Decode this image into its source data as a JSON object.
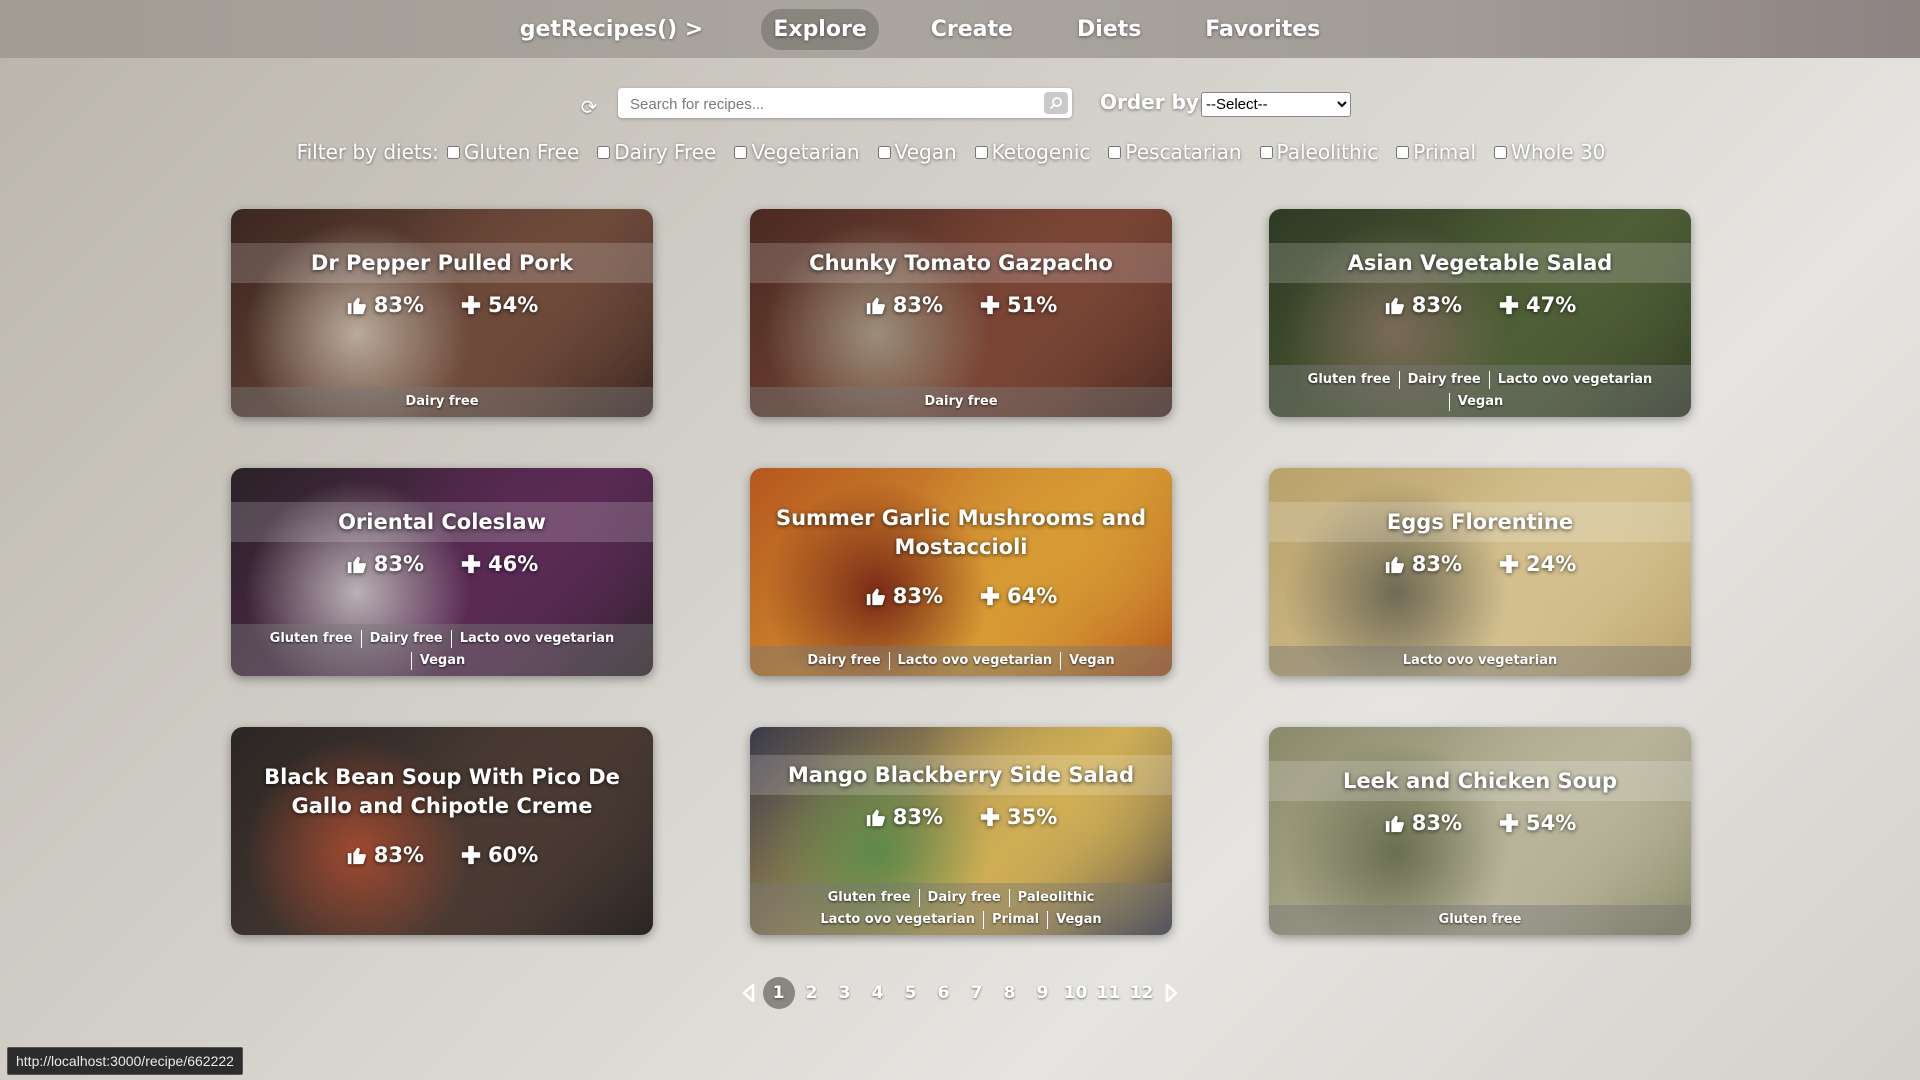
{
  "nav": {
    "brand": "getRecipes() >",
    "items": [
      "Explore",
      "Create",
      "Diets",
      "Favorites"
    ],
    "active": "Explore"
  },
  "search": {
    "placeholder": "Search for recipes...",
    "value": ""
  },
  "order": {
    "label": "Order by:",
    "selected": "--Select--"
  },
  "filters": {
    "label": "Filter by diets:",
    "options": [
      "Gluten Free",
      "Dairy Free",
      "Vegetarian",
      "Vegan",
      "Ketogenic",
      "Pescatarian",
      "Paleolithic",
      "Primal",
      "Whole 30"
    ]
  },
  "recipes": [
    {
      "title": "Dr Pepper Pulled Pork",
      "likes": "83%",
      "health": "54%",
      "diets": [
        "Dairy free"
      ],
      "colors": [
        "#3b2620",
        "#6e4a3a",
        "#b9aa9a"
      ]
    },
    {
      "title": "Chunky Tomato Gazpacho",
      "likes": "83%",
      "health": "51%",
      "diets": [
        "Dairy free"
      ],
      "colors": [
        "#4a2a22",
        "#7a4535",
        "#9b8e7a"
      ]
    },
    {
      "title": "Asian Vegetable Salad",
      "likes": "83%",
      "health": "47%",
      "diets": [
        "Gluten free",
        "Dairy free",
        "Lacto ovo vegetarian",
        "Vegan"
      ],
      "colors": [
        "#2e3a24",
        "#4e5e36",
        "#7a6a58"
      ]
    },
    {
      "title": "Oriental Coleslaw",
      "likes": "83%",
      "health": "46%",
      "diets": [
        "Gluten free",
        "Dairy free",
        "Lacto ovo vegetarian",
        "Vegan"
      ],
      "colors": [
        "#2a2226",
        "#5a2a55",
        "#b9b0b4"
      ]
    },
    {
      "title": "Summer Garlic Mushrooms and Mostaccioli",
      "likes": "83%",
      "health": "64%",
      "diets": [
        "Dairy free",
        "Lacto ovo vegetarian",
        "Vegan"
      ],
      "colors": [
        "#b5571e",
        "#d79a34",
        "#7a2a16"
      ]
    },
    {
      "title": "Eggs Florentine",
      "likes": "83%",
      "health": "24%",
      "diets": [
        "Lacto ovo vegetarian"
      ],
      "colors": [
        "#b9a16a",
        "#d3c08e",
        "#6f6a55"
      ]
    },
    {
      "title": "Black Bean Soup With Pico De Gallo and Chipotle Creme",
      "likes": "83%",
      "health": "60%",
      "diets": [],
      "colors": [
        "#2b2624",
        "#4a3a33",
        "#a04a30"
      ]
    },
    {
      "title": "Mango Blackberry Side Salad",
      "likes": "83%",
      "health": "35%",
      "diets": [
        "Gluten free",
        "Dairy free",
        "Paleolithic",
        "Lacto ovo vegetarian",
        "Primal",
        "Vegan"
      ],
      "colors": [
        "#3a3a4a",
        "#cfae55",
        "#5e8a4a"
      ]
    },
    {
      "title": "Leek and Chicken Soup",
      "likes": "83%",
      "health": "54%",
      "diets": [
        "Gluten free"
      ],
      "colors": [
        "#8a8a6a",
        "#b8b49a",
        "#6a6e50"
      ]
    }
  ],
  "pagination": {
    "pages": [
      "1",
      "2",
      "3",
      "4",
      "5",
      "6",
      "7",
      "8",
      "9",
      "10",
      "11",
      "12"
    ],
    "current": "1"
  },
  "status_bar": {
    "url": "http://localhost:3000/recipe/662222"
  }
}
